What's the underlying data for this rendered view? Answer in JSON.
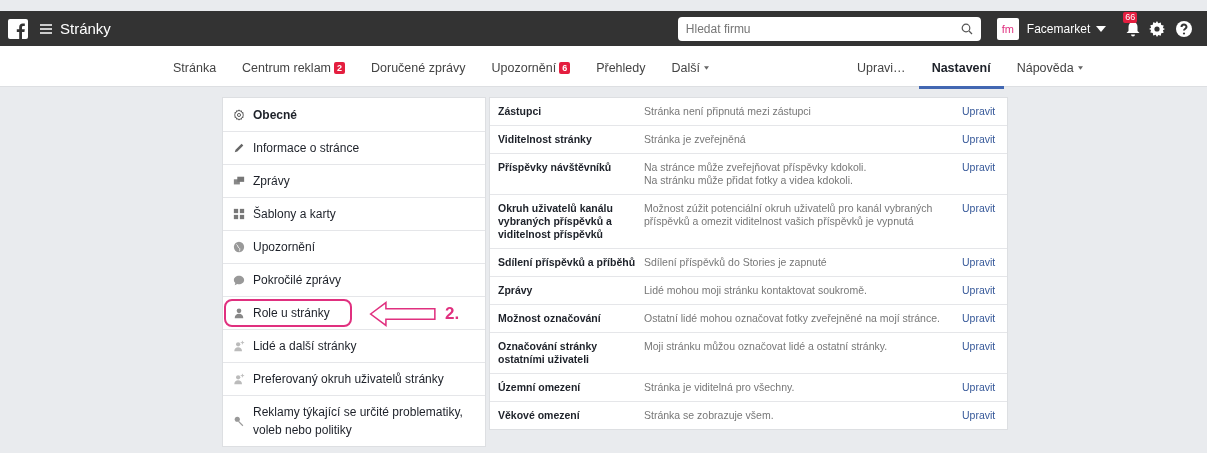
{
  "top_bar": {
    "title": "Stránky",
    "search": {
      "placeholder": "Hledat firmu"
    },
    "page_name": "Facemarket",
    "logo_text": "fm",
    "notifications": "66"
  },
  "tabs_left": [
    {
      "label": "Stránka",
      "menu": false,
      "selected": false
    },
    {
      "label": "Centrum reklam",
      "badge": "2",
      "menu": false,
      "selected": false
    },
    {
      "label": "Doručené zprávy",
      "menu": false,
      "selected": false
    },
    {
      "label": "Upozornění",
      "badge": "6",
      "menu": false,
      "selected": false
    },
    {
      "label": "Přehledy",
      "menu": false,
      "selected": false
    },
    {
      "label": "Další",
      "menu": true,
      "selected": false
    }
  ],
  "tabs_right": [
    {
      "label": "Upravi…",
      "menu": false,
      "selected": false
    },
    {
      "label": "Nastavení",
      "menu": false,
      "selected": true
    },
    {
      "label": "Nápověda",
      "menu": true,
      "selected": false
    }
  ],
  "sidebar": {
    "items": [
      {
        "label": "Obecné",
        "selected": true,
        "highlighted": false
      },
      {
        "label": "Informace o stránce",
        "selected": false,
        "highlighted": false
      },
      {
        "label": "Zprávy",
        "selected": false,
        "highlighted": false
      },
      {
        "label": "Šablony a karty",
        "selected": false,
        "highlighted": false
      },
      {
        "label": "Upozornění",
        "selected": false,
        "highlighted": false
      },
      {
        "label": "Pokročilé zprávy",
        "selected": false,
        "highlighted": false
      },
      {
        "label": "Role u stránky",
        "selected": false,
        "highlighted": true
      },
      {
        "label": "Lidé a další stránky",
        "selected": false,
        "highlighted": false
      },
      {
        "label": "Preferovaný okruh uživatelů stránky",
        "selected": false,
        "highlighted": false
      },
      {
        "label": "Reklamy týkající se určité problematiky, voleb nebo politiky",
        "selected": false,
        "highlighted": false
      }
    ]
  },
  "annotation": {
    "label": "2."
  },
  "settings": [
    {
      "name": "Zástupci",
      "value": "Stránka není připnutá mezi zástupci",
      "action": "Upravit"
    },
    {
      "name": "Viditelnost stránky",
      "value": "Stránka je zveřejněná",
      "action": "Upravit"
    },
    {
      "name": "Příspěvky návštěvníků",
      "value": "Na stránce může zveřejňovat příspěvky kdokoli.\nNa stránku může přidat fotky a videa kdokoli.",
      "action": "Upravit"
    },
    {
      "name": "Okruh uživatelů kanálu vybraných příspěvků a viditelnost příspěvků",
      "value": "Možnost zúžit potenciální okruh uživatelů pro kanál vybraných příspěvků a omezit viditelnost vašich příspěvků je vypnutá",
      "action": "Upravit"
    },
    {
      "name": "Sdílení příspěvků a příběhů",
      "value": "Sdílení příspěvků do Stories je zapnuté",
      "action": "Upravit"
    },
    {
      "name": "Zprávy",
      "value": "Lidé mohou moji stránku kontaktovat soukromě.",
      "action": "Upravit"
    },
    {
      "name": "Možnost označování",
      "value": "Ostatní lidé mohou označovat fotky zveřejněné na mojí stránce.",
      "action": "Upravit"
    },
    {
      "name": "Označování stránky ostatními uživateli",
      "value": "Moji stránku můžou označovat lidé a ostatní stránky.",
      "action": "Upravit"
    },
    {
      "name": "Územní omezení",
      "value": "Stránka je viditelná pro všechny.",
      "action": "Upravit"
    },
    {
      "name": "Věkové omezení",
      "value": "Stránka se zobrazuje všem.",
      "action": "Upravit"
    }
  ]
}
